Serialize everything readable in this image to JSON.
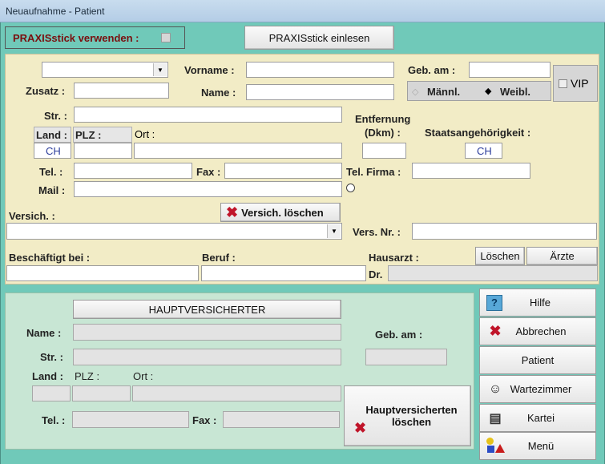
{
  "window": {
    "title": "Neuaufnahme - Patient"
  },
  "praxis": {
    "checkbox_label": "PRAXISstick verwenden :",
    "read_button": "PRAXISstick einlesen"
  },
  "patient": {
    "vorname_label": "Vorname :",
    "geb_label": "Geb. am :",
    "zusatz_label": "Zusatz :",
    "name_label": "Name :",
    "male": "Männl.",
    "female": "Weibl.",
    "vip": "VIP",
    "str_label": "Str. :",
    "land_label": "Land :",
    "plz_label": "PLZ :",
    "ort_label": "Ort :",
    "land_value": "CH",
    "distance_label_1": "Entfernung",
    "distance_label_2": "(Dkm) :",
    "nationality_label": "Staatsangehörigkeit :",
    "nationality_value": "CH",
    "tel_label": "Tel. :",
    "fax_label": "Fax :",
    "tel_firma_label": "Tel. Firma :",
    "mail_label": "Mail :",
    "versich_label": "Versich. :",
    "versich_delete": "Versich. löschen",
    "vers_nr_label": "Vers. Nr. :",
    "employer_label": "Beschäftigt bei :",
    "beruf_label": "Beruf :",
    "hausarzt_label": "Hausarzt :",
    "loeschen": "Löschen",
    "aerzte": "Ärzte",
    "dr_label": "Dr."
  },
  "main_insured": {
    "header": "HAUPTVERSICHERTER",
    "name_label": "Name :",
    "geb_label": "Geb. am :",
    "str_label": "Str. :",
    "land_label": "Land :",
    "plz_label": "PLZ :",
    "ort_label": "Ort :",
    "tel_label": "Tel. :",
    "fax_label": "Fax :",
    "delete_line1": "Hauptversicherten",
    "delete_line2": "löschen"
  },
  "side": {
    "hilfe": "Hilfe",
    "abbrechen": "Abbrechen",
    "patient": "Patient",
    "wartezimmer": "Wartezimmer",
    "kartei": "Kartei",
    "menu": "Menü"
  }
}
